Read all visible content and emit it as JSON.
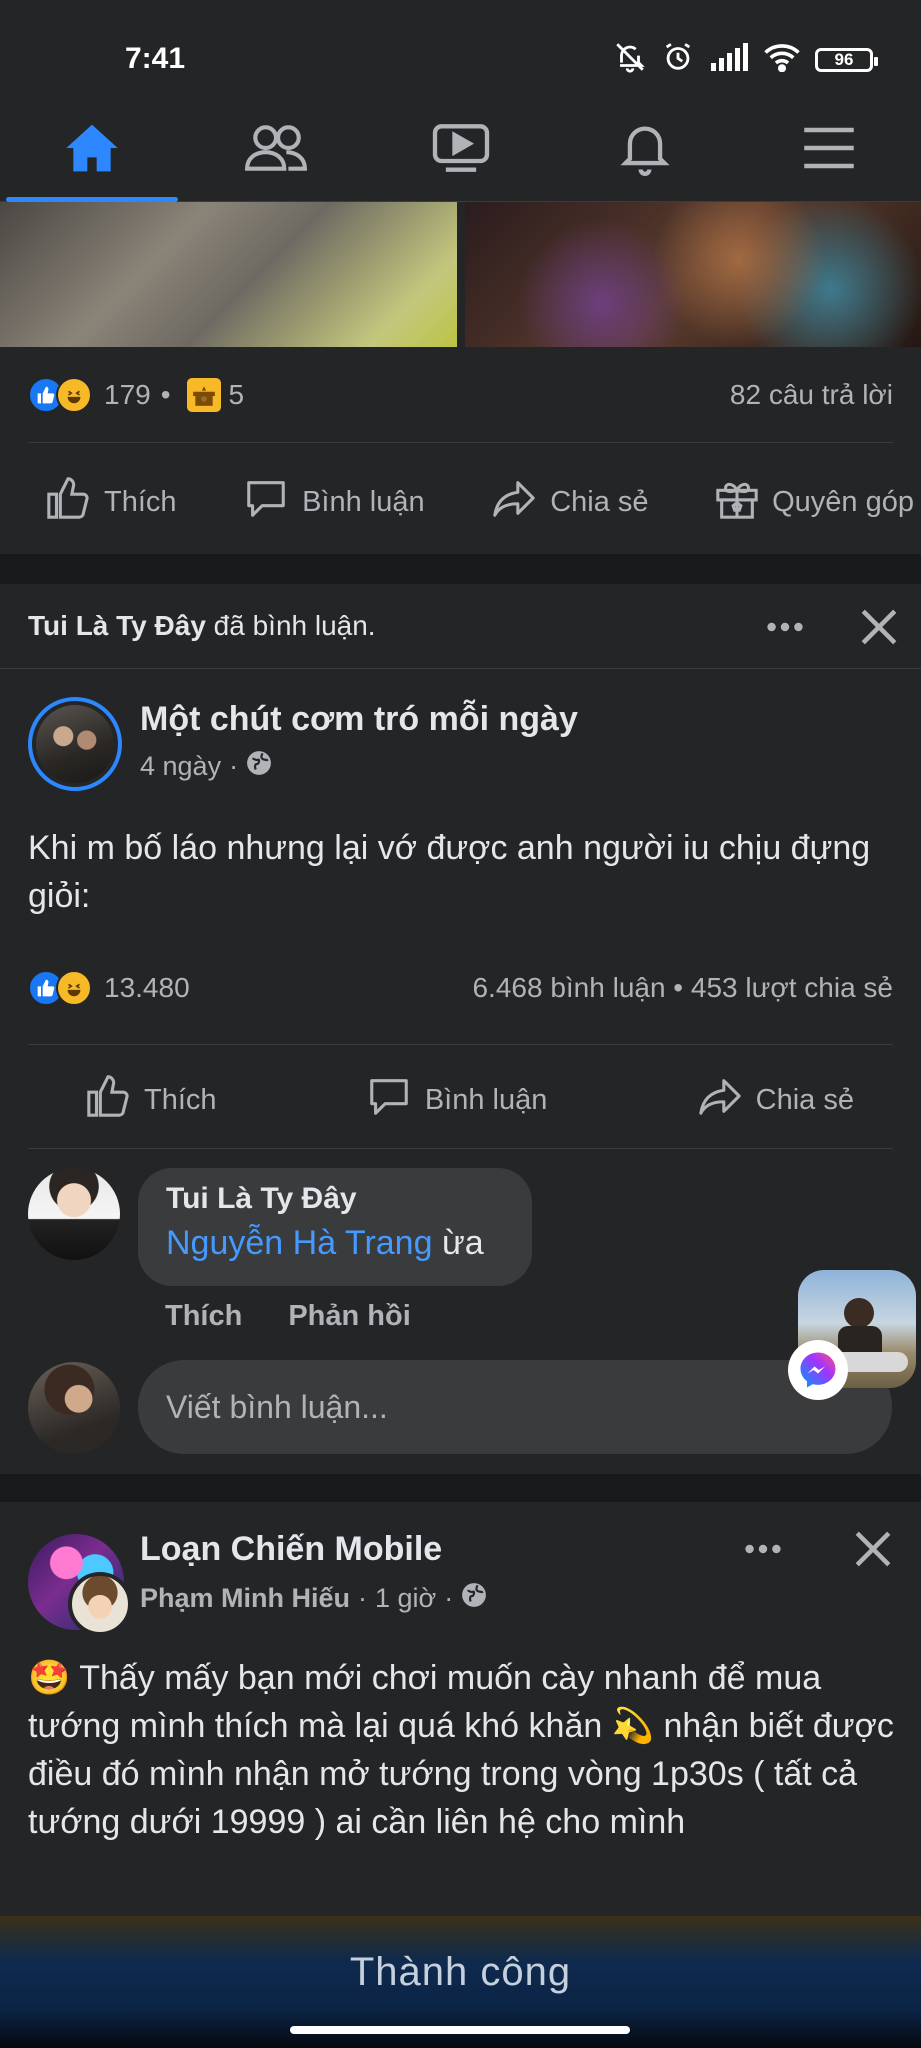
{
  "status_bar": {
    "time": "7:41",
    "battery": "96"
  },
  "tabs": [
    {
      "name": "home"
    },
    {
      "name": "friends"
    },
    {
      "name": "watch"
    },
    {
      "name": "notifications"
    },
    {
      "name": "menu"
    }
  ],
  "post1": {
    "reaction_count": "179",
    "sep": "•",
    "gift_count": "5",
    "replies": "82 câu trả lời",
    "actions": {
      "like": "Thích",
      "comment": "Bình luận",
      "share": "Chia sẻ",
      "donate": "Quyên góp"
    }
  },
  "post2": {
    "activity_actor": "Tui Là Ty Đây",
    "activity_text": "đã bình luận.",
    "page_name": "Một chút cơm tró mỗi ngày",
    "time": "4 ngày",
    "dot": "·",
    "body": "Khi m bố láo nhưng lại vớ được anh người iu chịu đựng giỏi:",
    "reaction_count": "13.480",
    "stats": "6.468 bình luận • 453 lượt chia sẻ",
    "actions": {
      "like": "Thích",
      "comment": "Bình luận",
      "share": "Chia sẻ"
    },
    "comment": {
      "author": "Tui Là Ty Đây",
      "mention": "Nguyễn Hà Trang",
      "text": "ừa",
      "like": "Thích",
      "reply": "Phản hồi"
    },
    "input_placeholder": "Viết bình luận..."
  },
  "post3": {
    "page_name": "Loạn Chiến Mobile",
    "author": "Phạm Minh Hiếu",
    "dot": "·",
    "time": "1 giờ",
    "body_emoji": "🤩",
    "body_part1": "Thấy mấy bạn mới chơi muốn cày nhanh để mua tướng mình thích mà lại quá khó khăn",
    "body_emoji2": "💫",
    "body_part2": "nhận biết được điều đó mình nhận mở tướng trong vòng 1p30s ( tất cả tướng dưới 19999 ) ai cần liên hệ cho mình"
  },
  "banner_text": "Thành công",
  "colors": {
    "accent": "#2d88ff",
    "link": "#4599ff",
    "background": "#18191a",
    "card": "#242526"
  }
}
